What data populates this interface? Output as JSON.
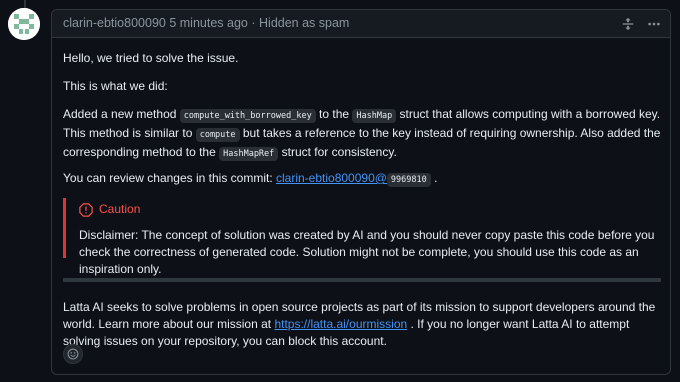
{
  "comment": {
    "author": "clarin-ebtio800090",
    "time": "5 minutes ago",
    "separator": "·",
    "status": "Hidden as spam"
  },
  "body": {
    "p1": "Hello, we tried to solve the issue.",
    "p2": "This is what we did:",
    "p3_a": "Added a new method ",
    "p3_code1": "compute_with_borrowed_key",
    "p3_b": " to the ",
    "p3_code2": "HashMap",
    "p3_c": " struct that allows computing with a borrowed key. This method is similar to ",
    "p3_code3": "compute",
    "p3_d": " but takes a reference to the key instead of requiring ownership. Also added the corresponding method to the ",
    "p3_code4": "HashMapRef",
    "p3_e": " struct for consistency.",
    "p4_a": "You can review changes in this commit: ",
    "p4_link": "clarin-ebtio800090@",
    "p4_commit": "9969810",
    "p4_b": " .",
    "caution_title": "Caution",
    "caution_text": "Disclaimer: The concept of solution was created by AI and you should never copy paste this code before you check the correctness of generated code. Solution might not be complete, you should use this code as an inspiration only.",
    "p5_a": "Latta AI seeks to solve problems in open source projects as part of its mission to support developers around the world. Learn more about our mission at ",
    "p5_link": "https://latta.ai/ourmission",
    "p5_b": " . If you no longer want Latta AI to attempt solving issues on your repository, you can block this account."
  },
  "icons": {
    "unfold": "unfold-icon",
    "more": "kebab-horizontal-icon",
    "reaction": "smiley-icon"
  },
  "colors": {
    "background": "#0d1117",
    "border": "#30363d",
    "muted_text": "#8b949e",
    "link": "#4493f8",
    "caution_red": "#f85149"
  }
}
